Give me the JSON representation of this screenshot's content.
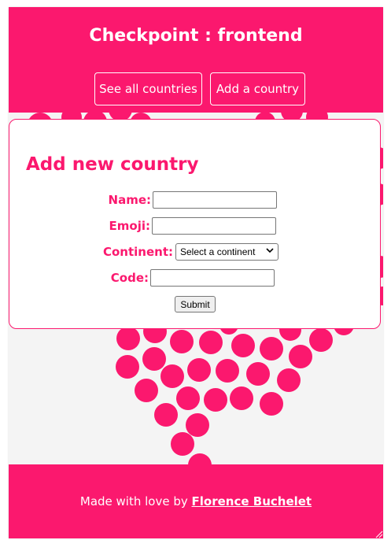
{
  "header": {
    "title": "Checkpoint : frontend",
    "nav": {
      "all_countries": "See all countries",
      "add_country": "Add a country"
    }
  },
  "form": {
    "title": "Add new country",
    "name_label": "Name:",
    "name_value": "",
    "emoji_label": "Emoji:",
    "emoji_value": "",
    "continent_label": "Continent:",
    "continent_selected": "Select a continent",
    "code_label": "Code:",
    "code_value": "",
    "submit_label": "Submit"
  },
  "footer": {
    "text": "Made with love by",
    "author": "Florence Buchelet"
  },
  "colors": {
    "brand": "#fb186e",
    "page_bg": "#f4f4f4"
  },
  "icons": {
    "select_chevron": "chevron-down-icon",
    "resize_handle": "resize-grip-icon"
  }
}
